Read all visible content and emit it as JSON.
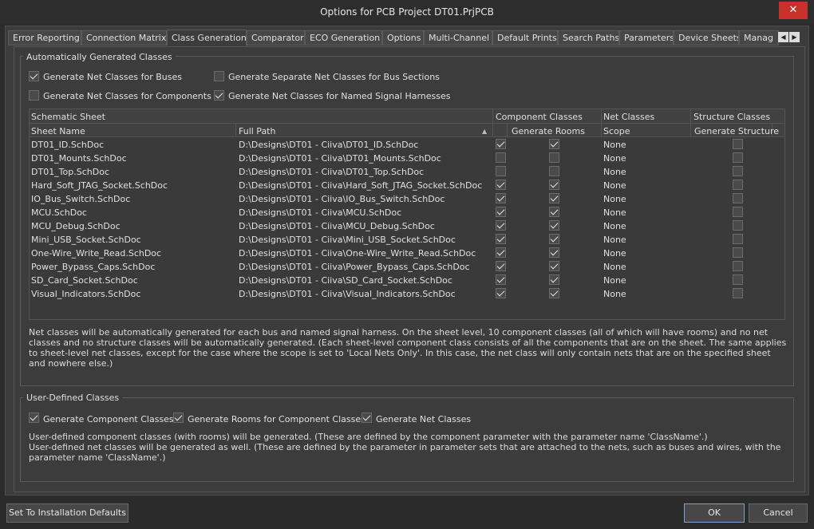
{
  "window": {
    "title": "Options for PCB Project DT01.PrjPCB",
    "close_glyph": "✕"
  },
  "tabs": [
    {
      "label": "Error Reporting"
    },
    {
      "label": "Connection Matrix"
    },
    {
      "label": "Class Generation"
    },
    {
      "label": "Comparator"
    },
    {
      "label": "ECO Generation"
    },
    {
      "label": "Options"
    },
    {
      "label": "Multi-Channel"
    },
    {
      "label": "Default Prints"
    },
    {
      "label": "Search Paths"
    },
    {
      "label": "Parameters"
    },
    {
      "label": "Device Sheets"
    },
    {
      "label": "Manag"
    }
  ],
  "tab_scroll": {
    "left": "◀",
    "right": "▶"
  },
  "auto": {
    "title": "Automatically Generated Classes",
    "options": [
      {
        "label": "Generate Net Classes for Buses",
        "checked": true
      },
      {
        "label": "Generate Separate Net Classes for Bus Sections",
        "checked": false
      },
      {
        "label": "Generate Net Classes for Components",
        "checked": false
      },
      {
        "label": "Generate Net Classes for Named Signal Harnesses",
        "checked": true
      }
    ]
  },
  "grid": {
    "group_headers": {
      "schematic_sheet": "Schematic Sheet",
      "component_classes": "Component Classes",
      "net_classes": "Net Classes",
      "structure_classes": "Structure Classes"
    },
    "columns": {
      "sheet_name": "Sheet Name",
      "full_path": "Full Path",
      "generate_rooms": "Generate Rooms",
      "scope": "Scope",
      "generate_structure": "Generate Structure"
    },
    "sort_glyph": "▲",
    "rows": [
      {
        "sheet": "DT01_ID.SchDoc",
        "path": "D:\\Designs\\DT01 - Ciiva\\DT01_ID.SchDoc",
        "comp": true,
        "rooms": true,
        "scope": "None",
        "structure": false
      },
      {
        "sheet": "DT01_Mounts.SchDoc",
        "path": "D:\\Designs\\DT01 - Ciiva\\DT01_Mounts.SchDoc",
        "comp": false,
        "rooms": false,
        "scope": "None",
        "structure": false
      },
      {
        "sheet": "DT01_Top.SchDoc",
        "path": "D:\\Designs\\DT01 - Ciiva\\DT01_Top.SchDoc",
        "comp": false,
        "rooms": false,
        "scope": "None",
        "structure": false
      },
      {
        "sheet": "Hard_Soft_JTAG_Socket.SchDoc",
        "path": "D:\\Designs\\DT01 - Ciiva\\Hard_Soft_JTAG_Socket.SchDoc",
        "comp": true,
        "rooms": true,
        "scope": "None",
        "structure": false
      },
      {
        "sheet": "IO_Bus_Switch.SchDoc",
        "path": "D:\\Designs\\DT01 - Ciiva\\IO_Bus_Switch.SchDoc",
        "comp": true,
        "rooms": true,
        "scope": "None",
        "structure": false
      },
      {
        "sheet": "MCU.SchDoc",
        "path": "D:\\Designs\\DT01 - Ciiva\\MCU.SchDoc",
        "comp": true,
        "rooms": true,
        "scope": "None",
        "structure": false
      },
      {
        "sheet": "MCU_Debug.SchDoc",
        "path": "D:\\Designs\\DT01 - Ciiva\\MCU_Debug.SchDoc",
        "comp": true,
        "rooms": true,
        "scope": "None",
        "structure": false
      },
      {
        "sheet": "Mini_USB_Socket.SchDoc",
        "path": "D:\\Designs\\DT01 - Ciiva\\Mini_USB_Socket.SchDoc",
        "comp": true,
        "rooms": true,
        "scope": "None",
        "structure": false
      },
      {
        "sheet": "One-Wire_Write_Read.SchDoc",
        "path": "D:\\Designs\\DT01 - Ciiva\\One-Wire_Write_Read.SchDoc",
        "comp": true,
        "rooms": true,
        "scope": "None",
        "structure": false
      },
      {
        "sheet": "Power_Bypass_Caps.SchDoc",
        "path": "D:\\Designs\\DT01 - Ciiva\\Power_Bypass_Caps.SchDoc",
        "comp": true,
        "rooms": true,
        "scope": "None",
        "structure": false
      },
      {
        "sheet": "SD_Card_Socket.SchDoc",
        "path": "D:\\Designs\\DT01 - Ciiva\\SD_Card_Socket.SchDoc",
        "comp": true,
        "rooms": true,
        "scope": "None",
        "structure": false
      },
      {
        "sheet": "Visual_Indicators.SchDoc",
        "path": "D:\\Designs\\DT01 - Ciiva\\Visual_Indicators.SchDoc",
        "comp": true,
        "rooms": true,
        "scope": "None",
        "structure": false
      }
    ]
  },
  "auto_description": "Net classes will be automatically generated for each bus and named signal harness. On the sheet level, 10 component classes (all of which will have rooms) and no net classes and no structure classes will be automatically generated. (Each sheet-level component class consists of all the components that are on the sheet. The same applies to sheet-level net classes, except for the case where the scope is set to 'Local Nets Only'. In this case, the net class will only contain nets that are on the specified sheet and nowhere else.)",
  "user": {
    "title": "User-Defined Classes",
    "options": [
      {
        "label": "Generate Component Classes",
        "checked": true
      },
      {
        "label": "Generate Rooms for Component Classes",
        "checked": true
      },
      {
        "label": "Generate Net Classes",
        "checked": true
      }
    ],
    "description_1": "User-defined component classes (with rooms) will be generated. (These are defined by the component parameter with the parameter name 'ClassName'.)",
    "description_2": "User-defined net classes will be generated as well. (These are defined by the parameter in parameter sets that are attached to the nets, such as buses and wires, with the parameter name 'ClassName'.)"
  },
  "buttons": {
    "defaults": "Set To Installation Defaults",
    "ok": "OK",
    "cancel": "Cancel"
  }
}
